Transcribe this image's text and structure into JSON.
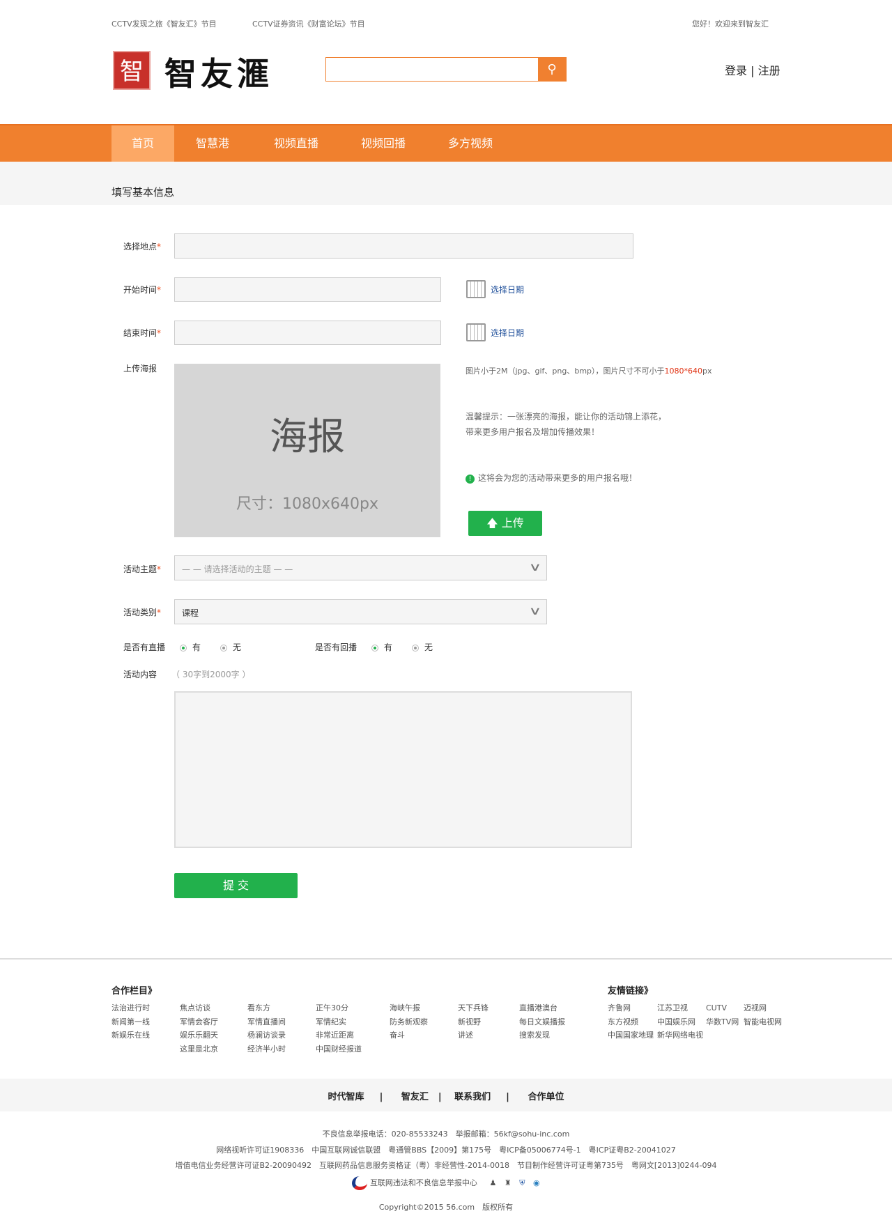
{
  "topbar": {
    "link1": "CCTV发现之旅《智友汇》节目",
    "link2": "CCTV证券资讯《财富论坛》节目",
    "welcome": "您好！欢迎来到智友汇"
  },
  "logo": {
    "seal": "智",
    "text": "智友滙"
  },
  "search": {
    "value": "",
    "placeholder": ""
  },
  "auth": {
    "login": "登录",
    "sep": "|",
    "register": "注册"
  },
  "nav": [
    "首页",
    "智慧港",
    "视频直播",
    "视频回播",
    "多方视频"
  ],
  "section_title": "填写基本信息",
  "form": {
    "location_label": "选择地点",
    "start_label": "开始时间",
    "end_label": "结束时间",
    "pick_date": "选择日期",
    "required": "*",
    "poster_label": "上传海报",
    "poster_title": "海报",
    "poster_size": "尺寸：1080x640px",
    "poster_rule": "图片小于2M（jpg、gif、png、bmp），图片尺寸不可小于",
    "poster_rule_size": "1080*640",
    "poster_rule_unit": "px",
    "tip1": "温馨提示：一张漂亮的海报，能让你的活动锦上添花，",
    "tip2": "带来更多用户报名及增加传播效果！",
    "notice": "这将会为您的活动带来更多的用户报名哦！",
    "upload": "上传",
    "theme_label": "活动主题",
    "theme_placeholder": "— — 请选择活动的主题 — —",
    "category_label": "活动类别",
    "category_value": "课程",
    "live_label": "是否有直播",
    "replay_label": "是否有回播",
    "yes": "有",
    "no": "无",
    "content_label": "活动内容",
    "content_hint": "（ 30字到2000字 ）",
    "submit": "提 交"
  },
  "footer": {
    "partners_title": "合作栏目》",
    "partners": [
      [
        "法治进行时",
        "新闻第一线",
        "新娱乐在线"
      ],
      [
        "焦点访谈",
        "军情会客厅",
        "娱乐乐翻天",
        "这里是北京"
      ],
      [
        "看东方",
        "军情直播间",
        "杨澜访谈录",
        "经济半小时"
      ],
      [
        "正午30分",
        "军情纪实",
        "非常近距离",
        "中国财经报道"
      ],
      [
        "海峡午报",
        "防务新观察",
        "奋斗"
      ],
      [
        "天下兵锋",
        "新视野",
        "讲述"
      ],
      [
        "直播港澳台",
        "每日文娱播报",
        "搜索发现"
      ]
    ],
    "friends_title": "友情链接》",
    "friends": [
      [
        "齐鲁网",
        "东方视频",
        "中国国家地理"
      ],
      [
        "江苏卫视",
        "中国娱乐网",
        "新华网络电视"
      ],
      [
        "CUTV",
        "华数TV网"
      ],
      [
        "迈视网",
        "智能电视网"
      ]
    ],
    "bar": [
      "时代智库",
      "智友汇",
      "联系我们",
      "合作单位"
    ],
    "info1": "不良信息举报电话：020-85533243　举报邮箱：56kf@sohu-inc.com",
    "info2": "网络视听许可证1908336　中国互联网诚信联盟　粤通管BBS【2009】第175号　粤ICP备05006774号-1　粤ICP证粤B2-20041027",
    "info3": "增值电信业务经营许可证B2-20090492　互联网药品信息服务资格证（粤）非经营性-2014-0018　节目制作经营许可证粤第735号　粤网文[2013]0244-094",
    "report_center": "互联网违法和不良信息举报中心",
    "copyright": "Copyright©2015 56.com　版权所有"
  }
}
